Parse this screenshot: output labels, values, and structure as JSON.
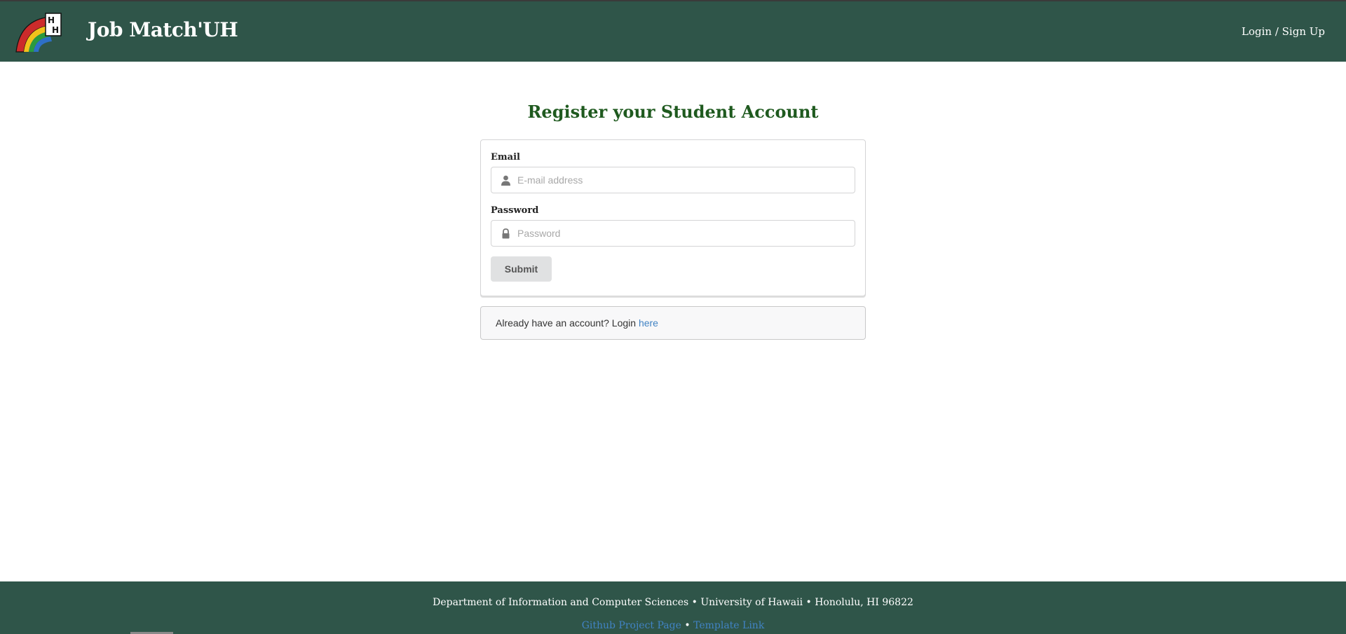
{
  "navbar": {
    "brand": "Job Match'UH",
    "login_link": "Login / Sign Up",
    "logo_icon": "rainbow-uh-logo-icon"
  },
  "page": {
    "heading": "Register your Student Account"
  },
  "form": {
    "email_label": "Email",
    "email_placeholder": "E-mail address",
    "email_value": "",
    "email_icon": "user-icon",
    "password_label": "Password",
    "password_placeholder": "Password",
    "password_value": "",
    "password_icon": "lock-icon",
    "submit_label": "Submit"
  },
  "message": {
    "text": "Already have an account? Login ",
    "link_text": "here"
  },
  "footer": {
    "address": "Department of Information and Computer Sciences • University of Hawaii • Honolulu, HI 96822",
    "github_link": "Github Project Page",
    "separator": " • ",
    "template_link": "Template Link"
  },
  "colors": {
    "header_bg": "#2f5549",
    "heading_green": "#1f5a1f",
    "link_blue": "#4183c4"
  }
}
